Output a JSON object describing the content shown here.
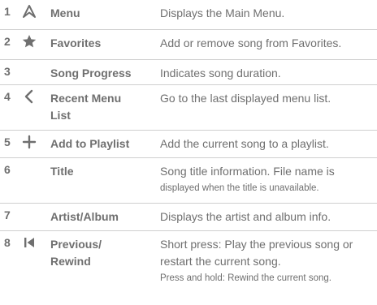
{
  "rows": [
    {
      "num": "1",
      "icon": "navigation-arrow-icon",
      "name": "Menu",
      "desc": "Displays the Main Menu."
    },
    {
      "num": "2",
      "icon": "star-icon",
      "name": "Favorites",
      "desc": "Add or remove song from Favorites."
    },
    {
      "num": "3",
      "icon": "",
      "name": "Song Progress",
      "desc": "Indicates song duration."
    },
    {
      "num": "4",
      "icon": "chevron-left-icon",
      "name": "Recent Menu List",
      "desc": "Go to the last displayed menu list."
    },
    {
      "num": "5",
      "icon": "plus-icon",
      "name": "Add to Playlist",
      "desc": "Add the current song to a playlist."
    },
    {
      "num": "6",
      "icon": "",
      "name": "Title",
      "desc": "Song title information. File name is",
      "desc_small": "displayed when the title is unavailable."
    },
    {
      "num": "7",
      "icon": "",
      "name": "Artist/Album",
      "desc": "Displays the artist and album info."
    },
    {
      "num": "8",
      "icon": "previous-track-icon",
      "name": "Previous/ Rewind",
      "desc": "Short press: Play the previous song or restart the current song.",
      "desc_small": "Press and hold: Rewind the current song."
    }
  ],
  "colors": {
    "text": "#6f6f6f",
    "divider": "#cfcfcf"
  }
}
